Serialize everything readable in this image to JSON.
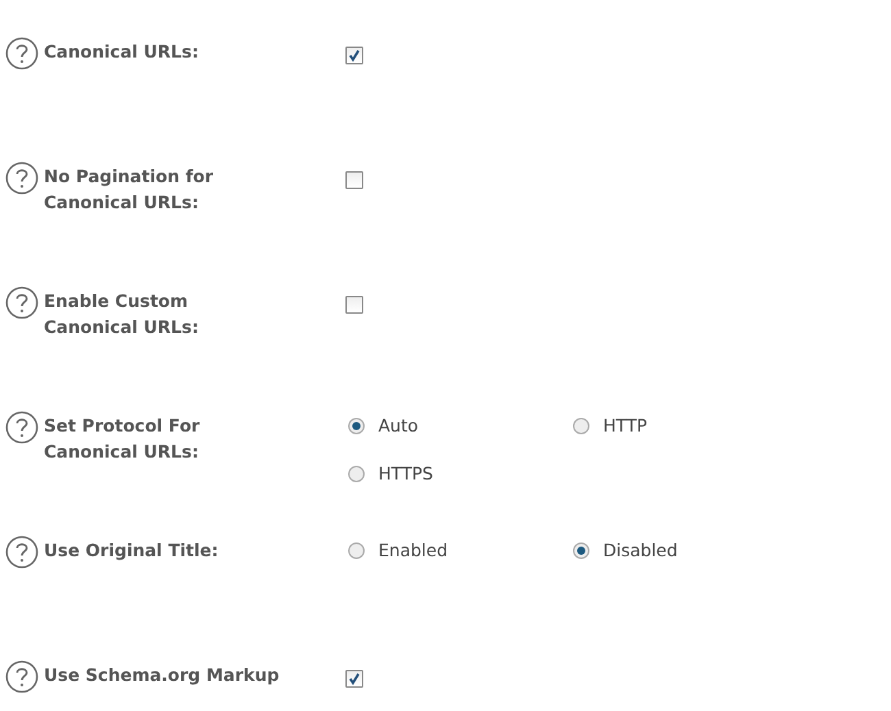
{
  "settings": [
    {
      "label": "Canonical URLs:",
      "kind": "checkbox",
      "checked": true
    },
    {
      "label": "No Pagination for Canonical URLs:",
      "kind": "checkbox",
      "checked": false
    },
    {
      "label": "Enable Custom Canonical URLs:",
      "kind": "checkbox",
      "checked": false
    },
    {
      "label": "Set Protocol For Canonical URLs:",
      "kind": "radio",
      "options": [
        {
          "label": "Auto",
          "selected": true
        },
        {
          "label": "HTTP",
          "selected": false
        },
        {
          "label": "HTTPS",
          "selected": false
        }
      ]
    },
    {
      "label": "Use Original Title:",
      "kind": "radio",
      "options": [
        {
          "label": "Enabled",
          "selected": false
        },
        {
          "label": "Disabled",
          "selected": true
        }
      ]
    },
    {
      "label": "Use Schema.org Markup",
      "kind": "checkbox",
      "checked": true
    }
  ]
}
